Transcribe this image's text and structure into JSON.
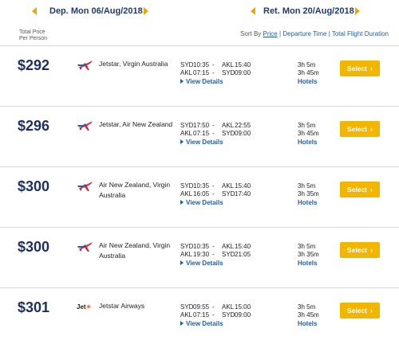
{
  "date_bar": {
    "departure_label": "Dep. Mon 06/Aug/2018",
    "return_label": "Ret. Mon 20/Aug/2018"
  },
  "total_price_label_1": "Total Price",
  "total_price_label_2": "Per Person",
  "sort": {
    "prefix": "Sort By",
    "price": "Price",
    "sep1": "|",
    "departure_time": "Departure Time",
    "sep2": "|",
    "duration": "Total Flight Duration"
  },
  "colors": {
    "accent": "#f2b600",
    "link": "#1f5fa8",
    "price": "#1f2f5e"
  },
  "view_details_label": "View Details",
  "hotels_label": "Hotels",
  "select_label": "Select",
  "results": [
    {
      "price": "$292",
      "logo": "plane-logo-icon",
      "airline": "Jetstar, Virgin Australia",
      "outbound": {
        "from": "SYD",
        "dep": "10:35",
        "dash": "-",
        "to": "AKL",
        "arr": "15:40"
      },
      "inbound": {
        "from": "AKL",
        "dep": "07:15",
        "dash": "-",
        "to": "SYD",
        "arr": "09:00"
      },
      "dur_out": "3h 5m",
      "dur_in": "3h 45m"
    },
    {
      "price": "$296",
      "logo": "plane-logo-icon",
      "airline": "Jetstar, Air New Zealand",
      "outbound": {
        "from": "SYD",
        "dep": "17:50",
        "dash": "-",
        "to": "AKL",
        "arr": "22:55"
      },
      "inbound": {
        "from": "AKL",
        "dep": "07:15",
        "dash": "-",
        "to": "SYD",
        "arr": "09:00"
      },
      "dur_out": "3h 5m",
      "dur_in": "3h 45m"
    },
    {
      "price": "$300",
      "logo": "plane-logo-icon",
      "airline": "Air New Zealand, Virgin Australia",
      "outbound": {
        "from": "SYD",
        "dep": "10:35",
        "dash": "-",
        "to": "AKL",
        "arr": "15:40"
      },
      "inbound": {
        "from": "AKL",
        "dep": "16:05",
        "dash": "-",
        "to": "SYD",
        "arr": "17:40"
      },
      "dur_out": "3h 5m",
      "dur_in": "3h 35m"
    },
    {
      "price": "$300",
      "logo": "plane-logo-icon",
      "airline": "Air New Zealand, Virgin Australia",
      "outbound": {
        "from": "SYD",
        "dep": "10:35",
        "dash": "-",
        "to": "AKL",
        "arr": "15:40"
      },
      "inbound": {
        "from": "AKL",
        "dep": "19:30",
        "dash": "-",
        "to": "SYD",
        "arr": "21:05"
      },
      "dur_out": "3h 5m",
      "dur_in": "3h 35m"
    },
    {
      "price": "$301",
      "logo": "jetstar-logo-icon",
      "logo_text": "Jet",
      "airline": "Jetstar Airways",
      "outbound": {
        "from": "SYD",
        "dep": "09:55",
        "dash": "-",
        "to": "AKL",
        "arr": "15:00"
      },
      "inbound": {
        "from": "AKL",
        "dep": "07:15",
        "dash": "-",
        "to": "SYD",
        "arr": "09:00"
      },
      "dur_out": "3h 5m",
      "dur_in": "3h 45m"
    }
  ]
}
